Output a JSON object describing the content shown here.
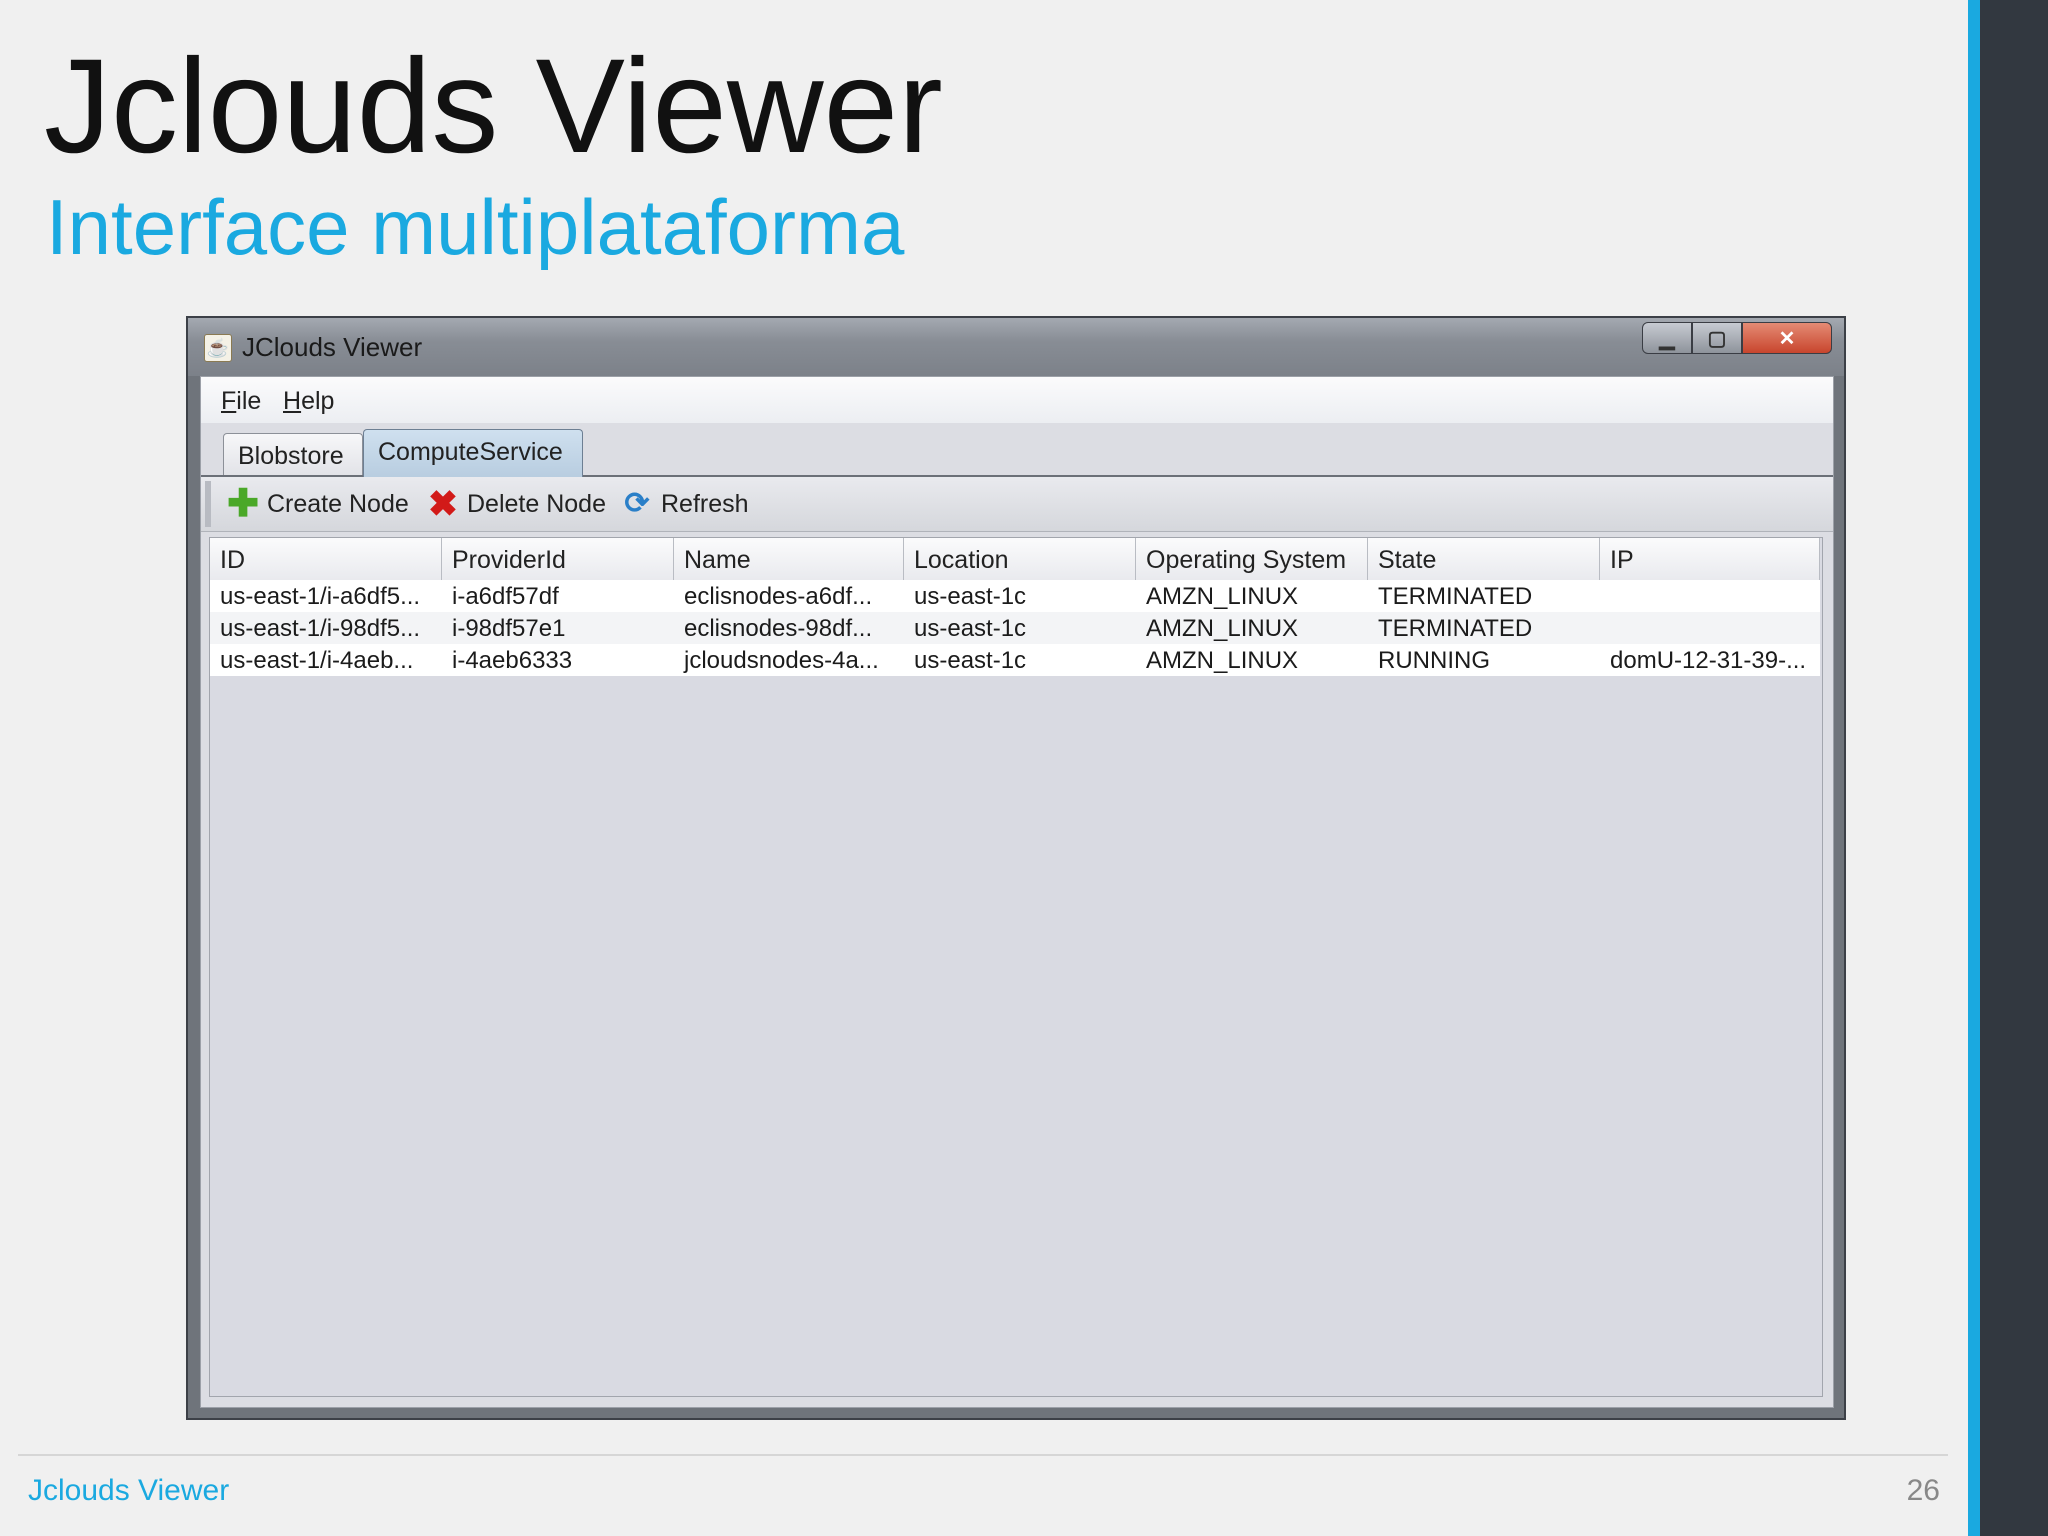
{
  "slide": {
    "title": "Jclouds Viewer",
    "subtitle": "Interface multiplataforma",
    "footer_left": "Jclouds Viewer",
    "page_number": "26",
    "accent_color": "#1aa9e0",
    "sidebar_dark_color": "#323840"
  },
  "window": {
    "title": "JClouds Viewer",
    "icon": "java-cup-icon",
    "controls": {
      "minimize": "minimize-icon",
      "maximize": "maximize-icon",
      "close": "close-icon"
    }
  },
  "menu": {
    "file": {
      "mnemonic": "F",
      "rest": "ile"
    },
    "help": {
      "mnemonic": "H",
      "rest": "elp"
    }
  },
  "tabs": [
    {
      "label": "Blobstore",
      "selected": false
    },
    {
      "label": "ComputeService",
      "selected": true
    }
  ],
  "toolbar": {
    "create": {
      "label": "Create Node",
      "icon": "plus-icon"
    },
    "delete": {
      "label": "Delete Node",
      "icon": "x-icon"
    },
    "refresh": {
      "label": "Refresh",
      "icon": "refresh-icon"
    }
  },
  "table": {
    "columns": [
      "ID",
      "ProviderId",
      "Name",
      "Location",
      "Operating System",
      "State",
      "IP"
    ],
    "rows": [
      [
        "us-east-1/i-a6df5...",
        "i-a6df57df",
        "eclisnodes-a6df...",
        "us-east-1c",
        "AMZN_LINUX",
        "TERMINATED",
        ""
      ],
      [
        "us-east-1/i-98df5...",
        "i-98df57e1",
        "eclisnodes-98df...",
        "us-east-1c",
        "AMZN_LINUX",
        "TERMINATED",
        ""
      ],
      [
        "us-east-1/i-4aeb...",
        "i-4aeb6333",
        "jcloudsnodes-4a...",
        "us-east-1c",
        "AMZN_LINUX",
        "RUNNING",
        "domU-12-31-39-..."
      ]
    ]
  }
}
